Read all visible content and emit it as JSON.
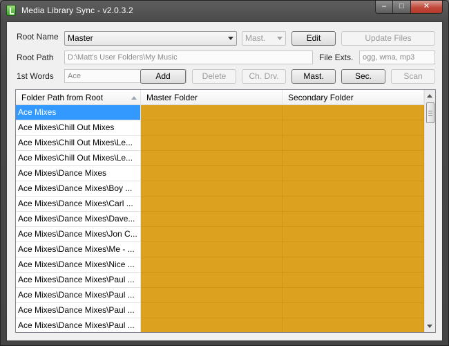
{
  "window": {
    "title": "Media Library Sync - v2.0.3.2",
    "icon": "app-logo-icon",
    "controls": {
      "minimize": "minimize-icon",
      "maximize": "maximize-icon",
      "close": "close-icon"
    }
  },
  "root_name": {
    "label": "Root Name",
    "value": "Master",
    "secondary_value": "Mast."
  },
  "root_path": {
    "label": "Root Path",
    "value": "D:\\Matt's User Folders\\My Music"
  },
  "file_exts": {
    "label": "File Exts.",
    "value": "ogg, wma, mp3"
  },
  "first_words": {
    "label": "1st Words",
    "value": "Ace"
  },
  "buttons": {
    "edit": "Edit",
    "update_files": "Update Files",
    "add": "Add",
    "delete": "Delete",
    "change_drive": "Ch. Drv.",
    "master": "Mast.",
    "secondary": "Sec.",
    "scan": "Scan"
  },
  "grid": {
    "columns": [
      "Folder Path from Root",
      "Master Folder",
      "Secondary Folder"
    ],
    "status_color": "#dca21f",
    "selected_color": "#3399ff",
    "rows": [
      "Ace Mixes",
      "Ace Mixes\\Chill Out Mixes",
      "Ace Mixes\\Chill Out Mixes\\Le...",
      "Ace Mixes\\Chill Out Mixes\\Le...",
      "Ace Mixes\\Dance Mixes",
      "Ace Mixes\\Dance Mixes\\Boy ...",
      "Ace Mixes\\Dance Mixes\\Carl ...",
      "Ace Mixes\\Dance Mixes\\Dave...",
      "Ace Mixes\\Dance Mixes\\Jon C...",
      "Ace Mixes\\Dance Mixes\\Me - ...",
      "Ace Mixes\\Dance Mixes\\Nice ...",
      "Ace Mixes\\Dance Mixes\\Paul ...",
      "Ace Mixes\\Dance Mixes\\Paul ...",
      "Ace Mixes\\Dance Mixes\\Paul ...",
      "Ace Mixes\\Dance Mixes\\Paul ..."
    ]
  }
}
